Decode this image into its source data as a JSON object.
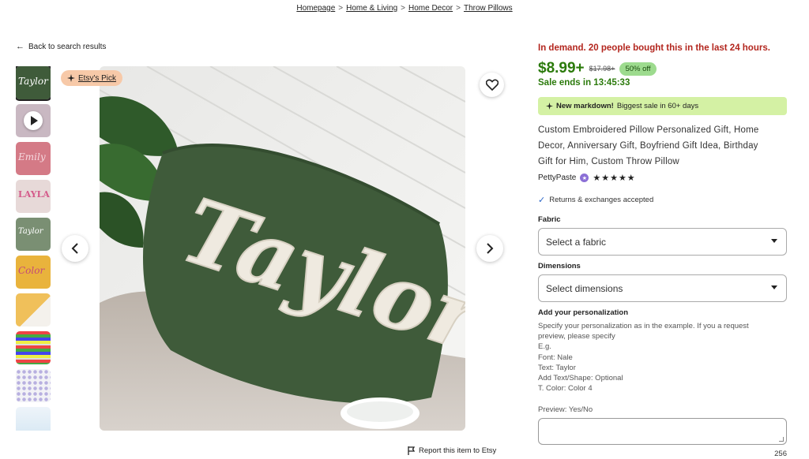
{
  "breadcrumb": [
    "Homepage",
    "Home & Living",
    "Home Decor",
    "Throw Pillows"
  ],
  "breadcrumb_separator": ">",
  "back_link": "Back to search results",
  "badge": {
    "label": "Etsy's Pick"
  },
  "main_image": {
    "text": "Taylor",
    "description_icon": "embroidered-pillow-image"
  },
  "thumbnails": [
    {
      "kind": "green pillow",
      "color": "#3f5b3a",
      "text": "Taylor"
    },
    {
      "kind": "video",
      "color": "#c9b8c2",
      "text": ""
    },
    {
      "kind": "pink pillow",
      "color": "#d47a86",
      "text": "Emily"
    },
    {
      "kind": "white pillow",
      "color": "#e7d9d8",
      "text": "LAYLA"
    },
    {
      "kind": "green pillow",
      "color": "#7a8f73",
      "text": "Taylor"
    },
    {
      "kind": "yellow pillow",
      "color": "#e9b33c",
      "text": "Color"
    },
    {
      "kind": "yellow pillow",
      "color": "#f0c05a",
      "text": ""
    },
    {
      "kind": "color chart",
      "color": "#c9c9c9",
      "text": ""
    },
    {
      "kind": "swatch chart",
      "color": "#e6e6ef",
      "text": ""
    },
    {
      "kind": "info chart",
      "color": "#dce8f0",
      "text": ""
    }
  ],
  "demand_text": "In demand. 20 people bought this in the last 24 hours.",
  "price": "$8.99+",
  "original_price": "$17.98+",
  "discount": "50% off",
  "sale_ends": "Sale ends in 13:45:33",
  "markdown": {
    "bold": "New markdown!",
    "rest": "Biggest sale in 60+ days"
  },
  "title": "Custom Embroidered Pillow Personalized Gift, Home Decor, Anniversary Gift, Boyfriend Gift Idea, Birthday Gift for Him, Custom Throw Pillow",
  "shop": {
    "name": "PettyPaste",
    "stars": "★★★★★"
  },
  "returns": "Returns & exchanges accepted",
  "fabric": {
    "label": "Fabric",
    "placeholder": "Select a fabric"
  },
  "dimensions": {
    "label": "Dimensions",
    "placeholder": "Select dimensions"
  },
  "personalization": {
    "label": "Add your personalization",
    "help": [
      "Specify your personalization as in the example. If you a request",
      "preview, please specify",
      "E.g.",
      "Font: Nale",
      "Text: Taylor",
      "Add Text/Shape: Optional",
      "T. Color: Color 4"
    ],
    "preview": "Preview: Yes/No",
    "char_count": "256"
  },
  "report": "Report this item to Etsy",
  "colors": {
    "demand": "#b3261e",
    "price": "#2b7a0b",
    "discount_bg": "#9ddb8e",
    "markdown_bg": "#d4f1a4",
    "badge_bg": "#f7c9a8",
    "pillow": "#3f5b3a"
  }
}
